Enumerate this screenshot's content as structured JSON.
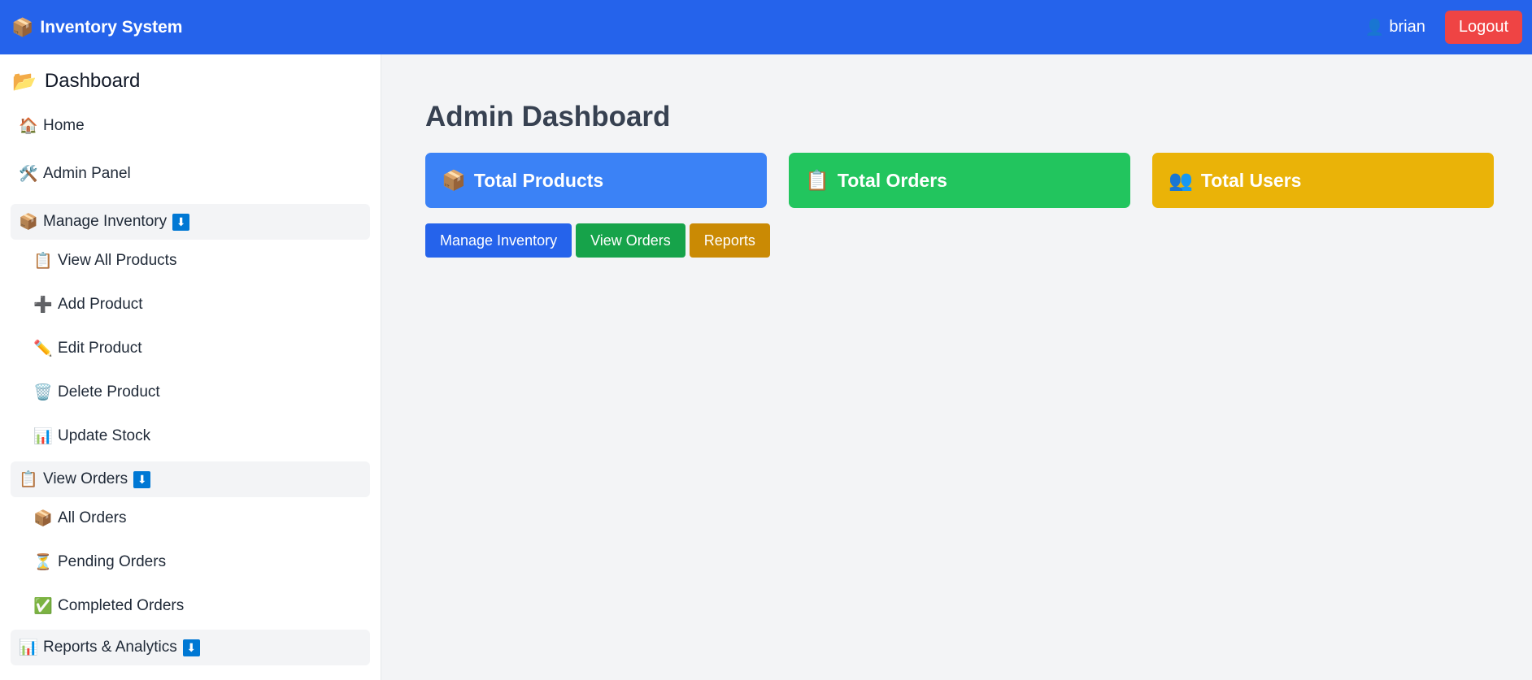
{
  "header": {
    "brand_icon": "📦",
    "brand_title": "Inventory System",
    "user_icon": "👤",
    "username": "brian",
    "logout_label": "Logout"
  },
  "sidebar": {
    "title_icon": "📂",
    "title": "Dashboard",
    "home": {
      "icon": "🏠",
      "label": "Home"
    },
    "admin": {
      "icon": "🛠️",
      "label": "Admin Panel"
    },
    "inventory": {
      "icon": "📦",
      "label": "Manage Inventory",
      "badge": "⬇",
      "items": [
        {
          "icon": "📋",
          "label": "View All Products"
        },
        {
          "icon": "➕",
          "label": "Add Product"
        },
        {
          "icon": "✏️",
          "label": "Edit Product"
        },
        {
          "icon": "🗑️",
          "label": "Delete Product"
        },
        {
          "icon": "📊",
          "label": "Update Stock"
        }
      ]
    },
    "orders": {
      "icon": "📋",
      "label": "View Orders",
      "badge": "⬇",
      "items": [
        {
          "icon": "📦",
          "label": "All Orders"
        },
        {
          "icon": "⏳",
          "label": "Pending Orders"
        },
        {
          "icon": "✅",
          "label": "Completed Orders"
        }
      ]
    },
    "reports": {
      "icon": "📊",
      "label": "Reports & Analytics",
      "badge": "⬇"
    }
  },
  "main": {
    "title": "Admin Dashboard",
    "cards": [
      {
        "icon": "📦",
        "label": "Total Products",
        "color": "#3b82f6"
      },
      {
        "icon": "📋",
        "label": "Total Orders",
        "color": "#22c55e"
      },
      {
        "icon": "👥",
        "label": "Total Users",
        "color": "#eab308"
      }
    ],
    "actions": [
      {
        "label": "Manage Inventory",
        "color": "#2563eb"
      },
      {
        "label": "View Orders",
        "color": "#16a34a"
      },
      {
        "label": "Reports",
        "color": "#ca8a04"
      }
    ]
  },
  "colors": {
    "topbar": "#2563eb",
    "logout": "#ef4444",
    "badge": "#0078d4",
    "background": "#f3f4f6"
  }
}
